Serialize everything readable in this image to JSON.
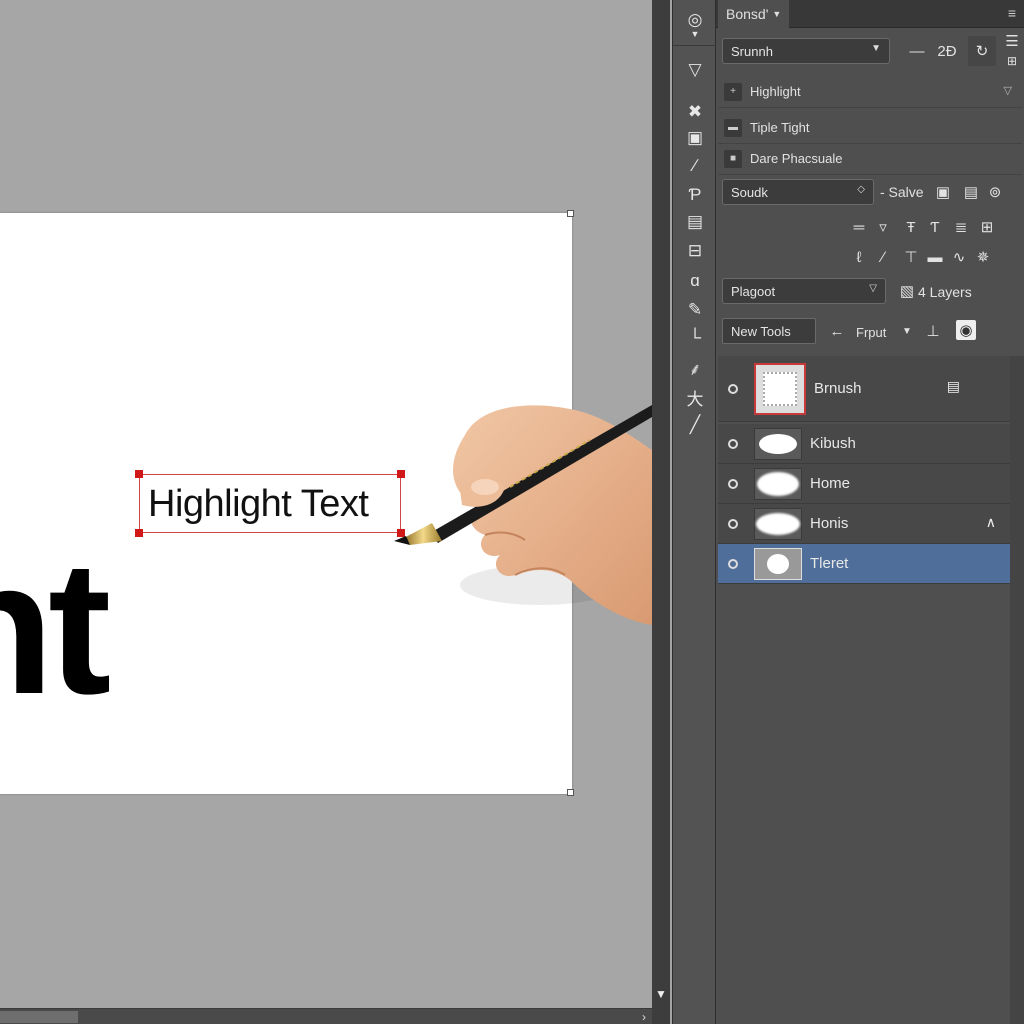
{
  "canvas": {
    "big_text": "ht",
    "selected_text": "Highlight Text",
    "selection_color": "#d01818"
  },
  "toolbar": {
    "tools": [
      {
        "name": "eye-dropper-tool",
        "glyph": "◎"
      },
      {
        "name": "fill-tool",
        "glyph": "▽"
      },
      {
        "name": "magic-wand-tool",
        "glyph": "✖"
      },
      {
        "name": "stamp-tool",
        "glyph": "▣"
      },
      {
        "name": "line-tool",
        "glyph": "∕"
      },
      {
        "name": "type-tool",
        "glyph": "Ƥ"
      },
      {
        "name": "frame-tool",
        "glyph": "▤"
      },
      {
        "name": "grid-tool",
        "glyph": "⊟"
      },
      {
        "name": "lasso-tool",
        "glyph": "ɑ"
      },
      {
        "name": "brush-tool",
        "glyph": "✎"
      },
      {
        "name": "crop-tool",
        "glyph": "└"
      },
      {
        "name": "pattern-tool",
        "glyph": "⸙"
      },
      {
        "name": "pin-tool",
        "glyph": "大"
      },
      {
        "name": "pen-tool",
        "glyph": "╱"
      }
    ]
  },
  "panel": {
    "tab_label": "Bonsd'",
    "font_dropdown": "Srunnh",
    "props": [
      {
        "label": "Highlight",
        "icon": "+"
      },
      {
        "label": "Tiple Tight",
        "icon": "▬"
      },
      {
        "label": "Dare Phacsuale",
        "icon": "■"
      }
    ],
    "style_dropdown": "Soudk",
    "save_label": "- Salve",
    "blend_dropdown": "Plagoot",
    "layers_count_label": "4 Layers",
    "new_tools_label": "New Tools",
    "front_label": "Frput",
    "layers": [
      {
        "name": "Brnush",
        "selected": false
      },
      {
        "name": "Kibush",
        "selected": false
      },
      {
        "name": "Home",
        "selected": false
      },
      {
        "name": "Honis",
        "selected": false
      },
      {
        "name": "Tleret",
        "selected": true
      }
    ],
    "selected_layer_color": "#4f6f9a"
  }
}
